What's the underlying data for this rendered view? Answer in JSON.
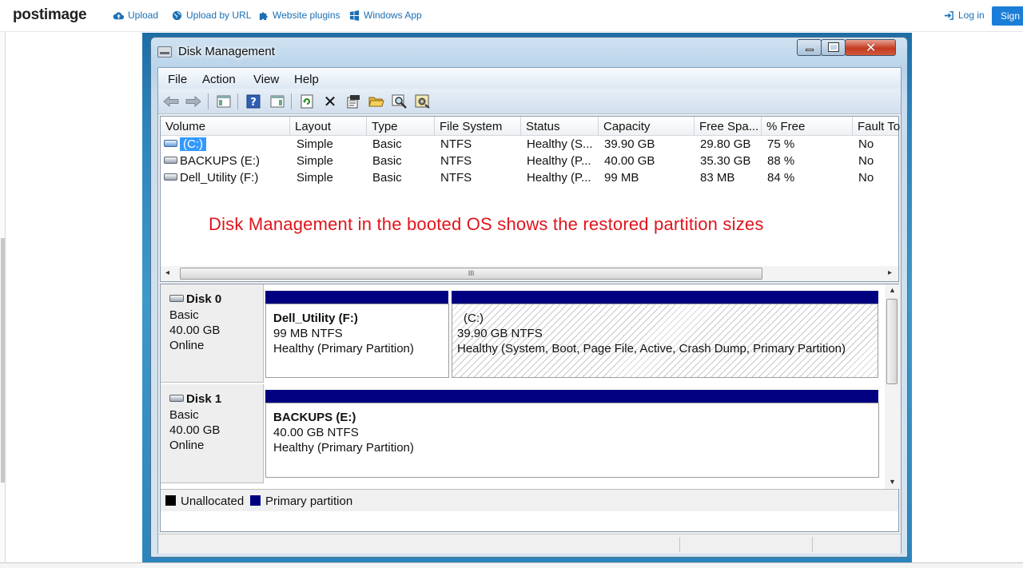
{
  "site": {
    "logo": "postimage",
    "nav": [
      {
        "label": "Upload",
        "icon": "cloud-upload-icon"
      },
      {
        "label": "Upload by URL",
        "icon": "globe-icon"
      },
      {
        "label": "Website plugins",
        "icon": "puzzle-icon"
      },
      {
        "label": "Windows App",
        "icon": "windows-logo-icon"
      }
    ],
    "login": "Log in",
    "signup": "Sign u"
  },
  "window": {
    "title": "Disk Management",
    "menu": [
      "File",
      "Action",
      "View",
      "Help"
    ],
    "toolbar_icons": [
      "back-icon",
      "forward-icon",
      "show-hide-console-tree-icon",
      "help-icon",
      "show-action-pane-icon",
      "refresh-icon",
      "delete-icon",
      "properties-icon",
      "open-folder-icon",
      "search-icon",
      "settings-icon"
    ]
  },
  "volume_list": {
    "columns": [
      "Volume",
      "Layout",
      "Type",
      "File System",
      "Status",
      "Capacity",
      "Free Spa...",
      "% Free",
      "Fault To"
    ],
    "rows": [
      {
        "volume": "(C:)",
        "layout": "Simple",
        "type": "Basic",
        "fs": "NTFS",
        "status": "Healthy (S...",
        "capacity": "39.90 GB",
        "free": "29.80 GB",
        "pct_free": "75 %",
        "fault": "No",
        "selected": true
      },
      {
        "volume": "BACKUPS (E:)",
        "layout": "Simple",
        "type": "Basic",
        "fs": "NTFS",
        "status": "Healthy (P...",
        "capacity": "40.00 GB",
        "free": "35.30 GB",
        "pct_free": "88 %",
        "fault": "No",
        "selected": false
      },
      {
        "volume": "Dell_Utility (F:)",
        "layout": "Simple",
        "type": "Basic",
        "fs": "NTFS",
        "status": "Healthy (P...",
        "capacity": "99 MB",
        "free": "83 MB",
        "pct_free": "84 %",
        "fault": "No",
        "selected": false
      }
    ],
    "annotation": "Disk Management in the booted OS shows the restored partition sizes",
    "annotation_color": "#e0141c",
    "scroll_grip": "III"
  },
  "disks": [
    {
      "name": "Disk 0",
      "type": "Basic",
      "size": "40.00 GB",
      "state": "Online",
      "partitions": [
        {
          "label": "Dell_Utility  (F:)",
          "size_fs": "99 MB NTFS",
          "status": "Healthy (Primary Partition)"
        },
        {
          "label": "(C:)",
          "size_fs": "39.90 GB NTFS",
          "status": "Healthy (System, Boot, Page File, Active, Crash Dump, Primary Partition)"
        }
      ]
    },
    {
      "name": "Disk 1",
      "type": "Basic",
      "size": "40.00 GB",
      "state": "Online",
      "partitions": [
        {
          "label": "BACKUPS  (E:)",
          "size_fs": "40.00 GB NTFS",
          "status": "Healthy (Primary Partition)"
        }
      ]
    }
  ],
  "legend": [
    {
      "label": "Unallocated",
      "color": "#000000"
    },
    {
      "label": "Primary partition",
      "color": "#000080"
    }
  ]
}
